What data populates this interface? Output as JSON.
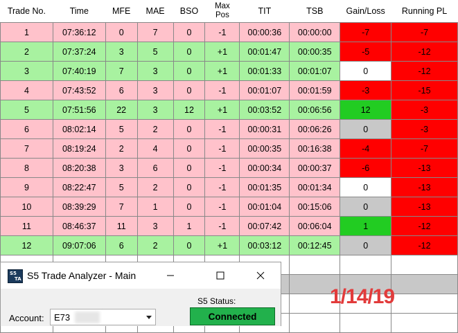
{
  "table": {
    "headers": [
      "Trade No.",
      "Time",
      "MFE",
      "MAE",
      "BSO",
      "Max Pos",
      "TIT",
      "TSB",
      "Gain/Loss",
      "Running PL"
    ],
    "rows": [
      {
        "no": "1",
        "time": "07:36:12",
        "mfe": "0",
        "mae": "7",
        "bso": "0",
        "maxpos": "-1",
        "tit": "00:00:36",
        "tsb": "00:00:00",
        "gl": "-7",
        "rpl": "-7"
      },
      {
        "no": "2",
        "time": "07:37:24",
        "mfe": "3",
        "mae": "5",
        "bso": "0",
        "maxpos": "+1",
        "tit": "00:01:47",
        "tsb": "00:00:35",
        "gl": "-5",
        "rpl": "-12"
      },
      {
        "no": "3",
        "time": "07:40:19",
        "mfe": "7",
        "mae": "3",
        "bso": "0",
        "maxpos": "+1",
        "tit": "00:01:33",
        "tsb": "00:01:07",
        "gl": "0",
        "rpl": "-12"
      },
      {
        "no": "4",
        "time": "07:43:52",
        "mfe": "6",
        "mae": "3",
        "bso": "0",
        "maxpos": "-1",
        "tit": "00:01:07",
        "tsb": "00:01:59",
        "gl": "-3",
        "rpl": "-15"
      },
      {
        "no": "5",
        "time": "07:51:56",
        "mfe": "22",
        "mae": "3",
        "bso": "12",
        "maxpos": "+1",
        "tit": "00:03:52",
        "tsb": "00:06:56",
        "gl": "12",
        "rpl": "-3"
      },
      {
        "no": "6",
        "time": "08:02:14",
        "mfe": "5",
        "mae": "2",
        "bso": "0",
        "maxpos": "-1",
        "tit": "00:00:31",
        "tsb": "00:06:26",
        "gl": "0",
        "rpl": "-3"
      },
      {
        "no": "7",
        "time": "08:19:24",
        "mfe": "2",
        "mae": "4",
        "bso": "0",
        "maxpos": "-1",
        "tit": "00:00:35",
        "tsb": "00:16:38",
        "gl": "-4",
        "rpl": "-7"
      },
      {
        "no": "8",
        "time": "08:20:38",
        "mfe": "3",
        "mae": "6",
        "bso": "0",
        "maxpos": "-1",
        "tit": "00:00:34",
        "tsb": "00:00:37",
        "gl": "-6",
        "rpl": "-13"
      },
      {
        "no": "9",
        "time": "08:22:47",
        "mfe": "5",
        "mae": "2",
        "bso": "0",
        "maxpos": "-1",
        "tit": "00:01:35",
        "tsb": "00:01:34",
        "gl": "0",
        "rpl": "-13"
      },
      {
        "no": "10",
        "time": "08:39:29",
        "mfe": "7",
        "mae": "1",
        "bso": "0",
        "maxpos": "-1",
        "tit": "00:01:04",
        "tsb": "00:15:06",
        "gl": "0",
        "rpl": "-13"
      },
      {
        "no": "11",
        "time": "08:46:37",
        "mfe": "11",
        "mae": "3",
        "bso": "1",
        "maxpos": "-1",
        "tit": "00:07:42",
        "tsb": "00:06:04",
        "gl": "1",
        "rpl": "-12"
      },
      {
        "no": "12",
        "time": "09:07:06",
        "mfe": "6",
        "mae": "2",
        "bso": "0",
        "maxpos": "+1",
        "tit": "00:03:12",
        "tsb": "00:12:45",
        "gl": "0",
        "rpl": "-12"
      }
    ]
  },
  "date_stamp": "1/14/19",
  "window": {
    "logo_text": [
      "S5",
      "TA"
    ],
    "title": "S5 Trade Analyzer - Main",
    "minimize_glyph": "—",
    "maximize_glyph": "☐",
    "close_glyph": "✕",
    "account_label": "Account:",
    "account_value": "E73",
    "status_label": "S5 Status:",
    "status_value": "Connected"
  },
  "colors": {
    "row_loss": "#ffc2cb",
    "row_win": "#a8f2a0",
    "negative": "#ff0000",
    "positive": "#22cc22",
    "neutral": "#c8c8c8",
    "date_stamp": "#e23b3b",
    "status_connected": "#22b14c"
  }
}
